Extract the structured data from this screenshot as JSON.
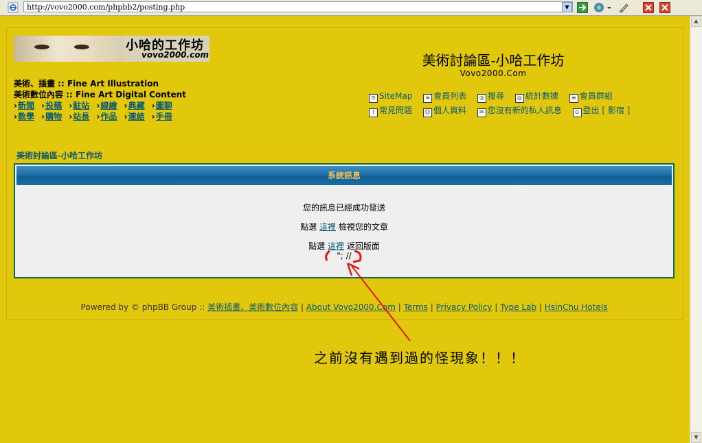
{
  "browser": {
    "address": "http://vovo2000.com/phpbb2/posting.php"
  },
  "logo": {
    "title": "小哈的工作坊",
    "url": "vovo2000.com"
  },
  "site": {
    "title": "美術討論區-小哈工作坊",
    "subtitle": "Vovo2000.Com"
  },
  "categories": {
    "line1": "美術、插畫 :: Fine Art Illustration",
    "line2": "美術數位內容 :: Fine Art Digital Content"
  },
  "sublinks_row1": [
    "新聞",
    "投稿",
    "駐站",
    "線繪",
    "典藏",
    "圖聊"
  ],
  "sublinks_row2": [
    "教學",
    "購物",
    "站長",
    "作品",
    "連結",
    "手冊"
  ],
  "nav_row1": [
    "SiteMap",
    "會員列表",
    "搜尋",
    "統計數據",
    "會員群組"
  ],
  "nav_row2": [
    "常見問題",
    "個人資料",
    "您沒有新的私人訊息",
    "登出 [ 影宿 ]"
  ],
  "forum_link": "美術討論區-小哈工作坊",
  "message": {
    "header": "系統訊息",
    "line1": "您的訊息已經成功發送",
    "line2_pre": "點選",
    "line2_link": "這裡",
    "line2_post": "檢視您的文章",
    "line3_pre": "點選",
    "line3_link": "這裡",
    "line3_post": "返回版面",
    "stray": "\"; //"
  },
  "footer": {
    "powered": "Powered by © phpBB Group ::",
    "links": [
      "美術插畫、美術數位內容",
      "About Vovo2000.Com",
      "Terms",
      "Privacy Policy",
      "Type Lab",
      "HsinChu Hotels"
    ]
  },
  "annotation": "之前沒有遇到過的怪現象！！！",
  "colors": {
    "page_bg": "#e2c80c",
    "link": "#0a5a74",
    "header_gradient": "#1f6fa8",
    "header_text": "#f4c15a",
    "annotation_red": "#e01818"
  }
}
